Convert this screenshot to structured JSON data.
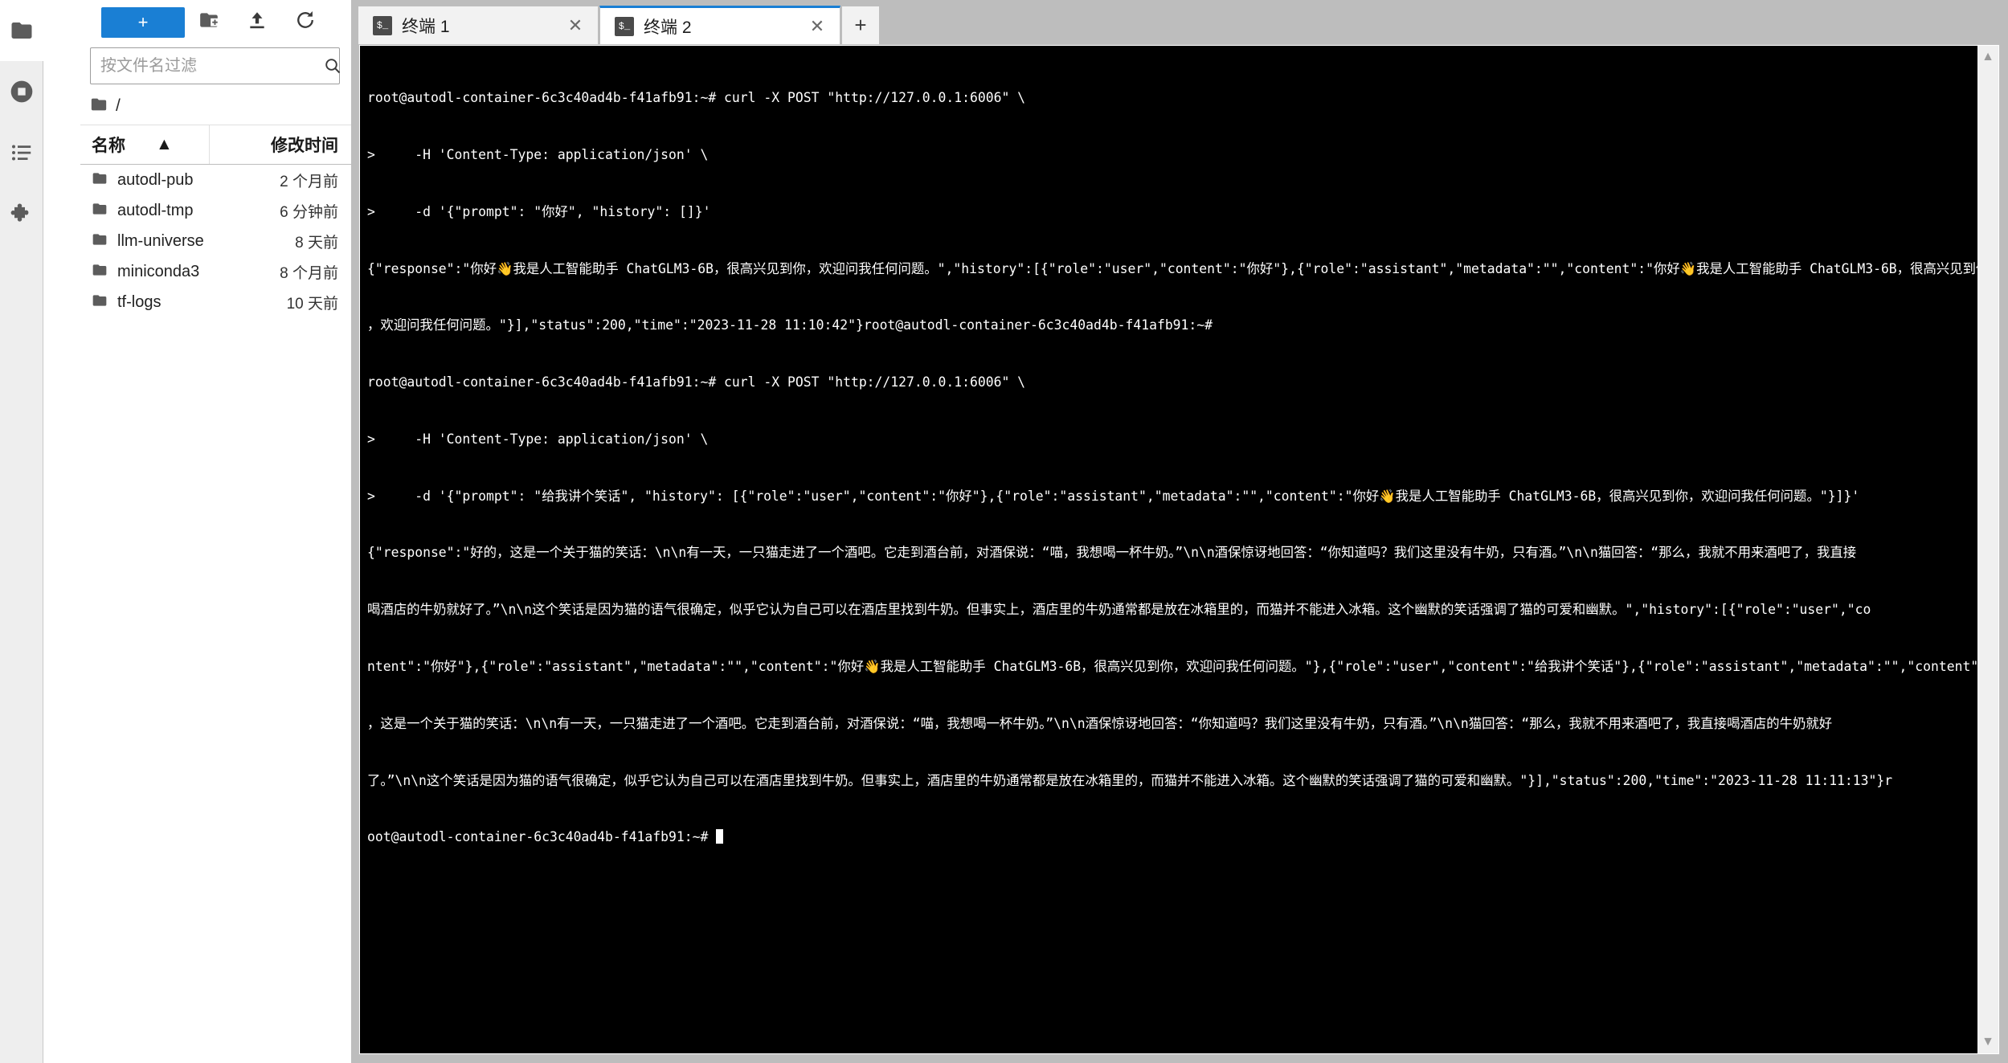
{
  "activity_bar": {
    "items": [
      {
        "name": "file-browser",
        "icon": "folder-icon",
        "active": true
      },
      {
        "name": "running-terminals-kernels",
        "icon": "stop-circle-icon",
        "active": false
      },
      {
        "name": "table-of-contents",
        "icon": "list-icon",
        "active": false
      },
      {
        "name": "extension-manager",
        "icon": "puzzle-icon",
        "active": false
      }
    ]
  },
  "file_browser": {
    "toolbar": {
      "new_launcher_label": "+",
      "new_folder_icon": "new-folder-icon",
      "upload_icon": "upload-icon",
      "refresh_icon": "refresh-icon"
    },
    "filter": {
      "value": "",
      "placeholder": "按文件名过滤",
      "search_icon": "search-icon"
    },
    "breadcrumb": {
      "root_icon": "folder-icon",
      "path": "/"
    },
    "columns": {
      "name": "名称",
      "modified": "修改时间",
      "sort_caret": "▲"
    },
    "rows": [
      {
        "icon": "folder-icon",
        "name": "autodl-pub",
        "modified": "2 个月前"
      },
      {
        "icon": "folder-icon",
        "name": "autodl-tmp",
        "modified": "6 分钟前"
      },
      {
        "icon": "folder-icon",
        "name": "llm-universe",
        "modified": "8 天前"
      },
      {
        "icon": "folder-icon",
        "name": "miniconda3",
        "modified": "8 个月前"
      },
      {
        "icon": "folder-icon",
        "name": "tf-logs",
        "modified": "10 天前"
      }
    ]
  },
  "tabs": {
    "items": [
      {
        "icon": "terminal-icon",
        "icon_glyph": "$_",
        "label": "终端 1",
        "close": "✕",
        "active": false
      },
      {
        "icon": "terminal-icon",
        "icon_glyph": "$_",
        "label": "终端 2",
        "close": "✕",
        "active": true
      }
    ],
    "add_label": "+"
  },
  "terminal": {
    "scrollbar": {
      "up": "▲",
      "down": "▼"
    },
    "prompt": "root@autodl-container-6c3c40ad4b-f41afb91:~#",
    "lines": [
      "root@autodl-container-6c3c40ad4b-f41afb91:~# curl -X POST \"http://127.0.0.1:6006\" \\",
      ">     -H 'Content-Type: application/json' \\",
      ">     -d '{\"prompt\": \"你好\", \"history\": []}'",
      "{\"response\":\"你好👋我是人工智能助手 ChatGLM3-6B，很高兴见到你，欢迎问我任何问题。\",\"history\":[{\"role\":\"user\",\"content\":\"你好\"},{\"role\":\"assistant\",\"metadata\":\"\",\"content\":\"你好👋我是人工智能助手 ChatGLM3-6B，很高兴见到你",
      "，欢迎问我任何问题。\"}],\"status\":200,\"time\":\"2023-11-28 11:10:42\"}root@autodl-container-6c3c40ad4b-f41afb91:~#",
      "root@autodl-container-6c3c40ad4b-f41afb91:~# curl -X POST \"http://127.0.0.1:6006\" \\",
      ">     -H 'Content-Type: application/json' \\",
      ">     -d '{\"prompt\": \"给我讲个笑话\", \"history\": [{\"role\":\"user\",\"content\":\"你好\"},{\"role\":\"assistant\",\"metadata\":\"\",\"content\":\"你好👋我是人工智能助手 ChatGLM3-6B，很高兴见到你，欢迎问我任何问题。\"}]}'",
      "{\"response\":\"好的，这是一个关于猫的笑话：\\n\\n有一天，一只猫走进了一个酒吧。它走到酒台前，对酒保说：“喵，我想喝一杯牛奶。”\\n\\n酒保惊讶地回答：“你知道吗？我们这里没有牛奶，只有酒。”\\n\\n猫回答：“那么，我就不用来酒吧了，我直接",
      "喝酒店的牛奶就好了。”\\n\\n这个笑话是因为猫的语气很确定，似乎它认为自己可以在酒店里找到牛奶。但事实上，酒店里的牛奶通常都是放在冰箱里的，而猫并不能进入冰箱。这个幽默的笑话强调了猫的可爱和幽默。\",\"history\":[{\"role\":\"user\",\"co",
      "ntent\":\"你好\"},{\"role\":\"assistant\",\"metadata\":\"\",\"content\":\"你好👋我是人工智能助手 ChatGLM3-6B，很高兴见到你，欢迎问我任何问题。\"},{\"role\":\"user\",\"content\":\"给我讲个笑话\"},{\"role\":\"assistant\",\"metadata\":\"\",\"content\":\"好的",
      "，这是一个关于猫的笑话：\\n\\n有一天，一只猫走进了一个酒吧。它走到酒台前，对酒保说：“喵，我想喝一杯牛奶。”\\n\\n酒保惊讶地回答：“你知道吗？我们这里没有牛奶，只有酒。”\\n\\n猫回答：“那么，我就不用来酒吧了，我直接喝酒店的牛奶就好",
      "了。”\\n\\n这个笑话是因为猫的语气很确定，似乎它认为自己可以在酒店里找到牛奶。但事实上，酒店里的牛奶通常都是放在冰箱里的，而猫并不能进入冰箱。这个幽默的笑话强调了猫的可爱和幽默。\"}],\"status\":200,\"time\":\"2023-11-28 11:11:13\"}r",
      "oot@autodl-container-6c3c40ad4b-f41afb91:~# "
    ]
  },
  "colors": {
    "accent": "#1a7fd4",
    "chrome": "#bdbdbd",
    "panel": "#eeeeee",
    "terminal_bg": "#000000",
    "terminal_fg": "#ffffff"
  }
}
